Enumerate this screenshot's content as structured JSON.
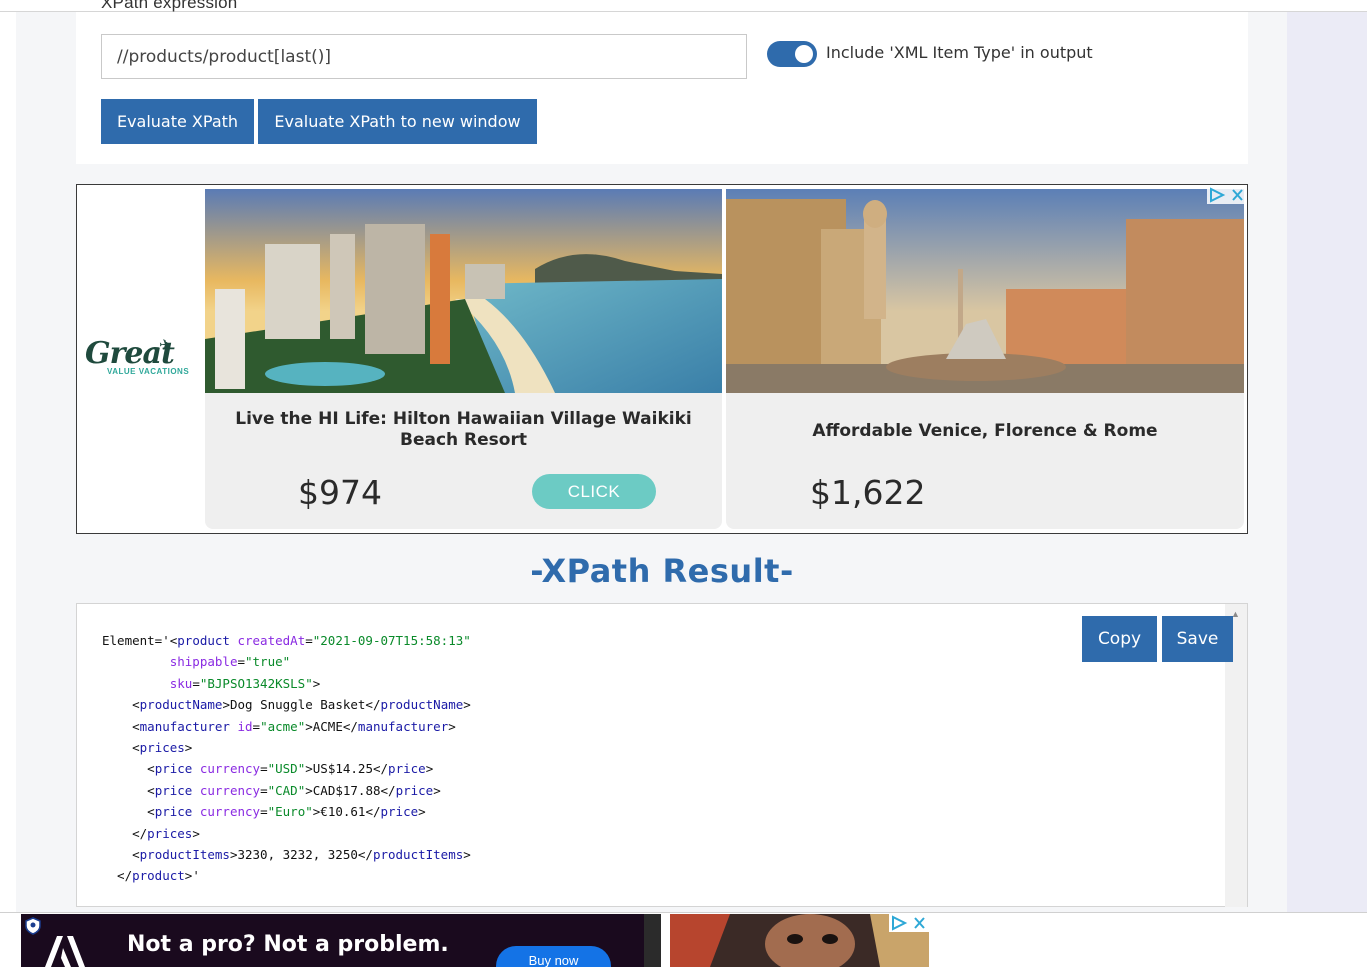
{
  "form": {
    "partial_label": "XPath expression",
    "xpath_value": "//products/product[last()]",
    "toggle_label": "Include 'XML Item Type' in output",
    "toggle_on": true,
    "evaluate_label": "Evaluate XPath",
    "evaluate_new_window_label": "Evaluate XPath to new window"
  },
  "ad": {
    "logo_text": "Great",
    "logo_sub": "VALUE VACATIONS",
    "cards": [
      {
        "title": "Live the HI Life: Hilton Hawaiian Village Waikiki Beach Resort",
        "price": "$974",
        "cta": "CLICK"
      },
      {
        "title": "Affordable Venice, Florence & Rome",
        "price": "$1,622"
      }
    ]
  },
  "result": {
    "title": "-XPath Result-",
    "copy_label": "Copy",
    "save_label": "Save"
  },
  "bottom_ad": {
    "headline": "Not a pro? Not a problem.",
    "cta": "Buy now"
  },
  "colors": {
    "primary": "#2f6bac",
    "cta_teal": "#6ccbc4",
    "tag": "#1a1aa6",
    "attr": "#8a2be2",
    "value": "#0a8a2a"
  }
}
